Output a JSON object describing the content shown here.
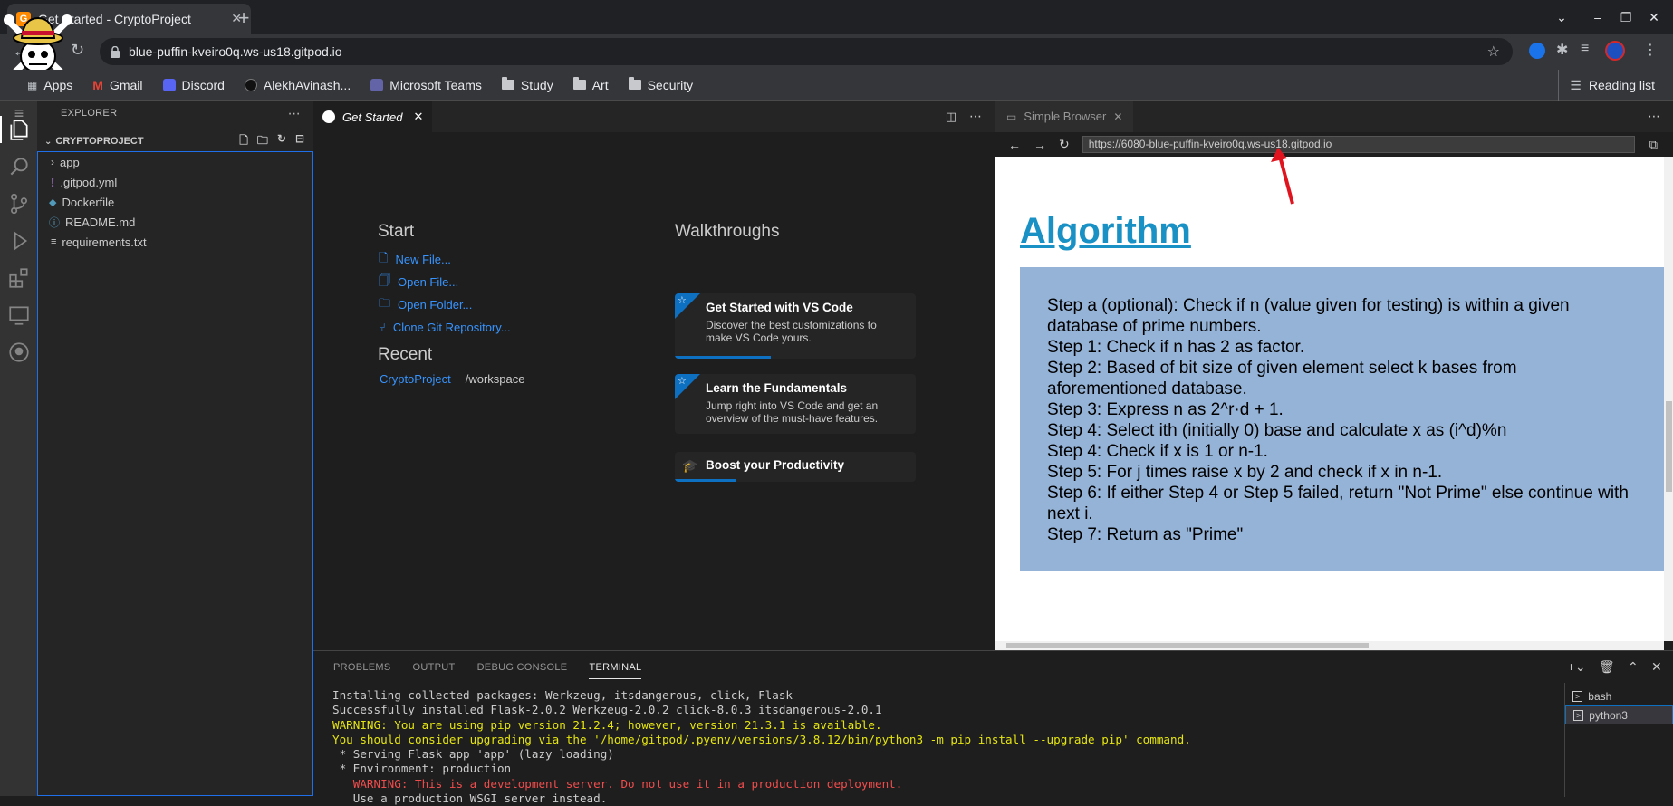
{
  "chrome": {
    "tab_title": "Get Started - CryptoProject",
    "url": "blue-puffin-kveiro0q.ws-us18.gitpod.io",
    "bookmarks": [
      "Apps",
      "Gmail",
      "Discord",
      "AlekhAvinash...",
      "Microsoft Teams",
      "Study",
      "Art",
      "Security"
    ],
    "reading_list": "Reading list"
  },
  "explorer": {
    "header": "EXPLORER",
    "project": "CRYPTOPROJECT",
    "files": [
      "app",
      ".gitpod.yml",
      "Dockerfile",
      "README.md",
      "requirements.txt"
    ]
  },
  "editor": {
    "tab_label": "Get Started",
    "start_heading": "Start",
    "start_links": [
      "New File...",
      "Open File...",
      "Open Folder...",
      "Clone Git Repository..."
    ],
    "recent_heading": "Recent",
    "recent_project": "CryptoProject",
    "recent_path": "/workspace",
    "walkthroughs_heading": "Walkthroughs",
    "walkthroughs": [
      {
        "title": "Get Started with VS Code",
        "desc": "Discover the best customizations to make VS Code yours.",
        "progress": 0.4
      },
      {
        "title": "Learn the Fundamentals",
        "desc": "Jump right into VS Code and get an overview of the must-have features.",
        "progress": 0
      },
      {
        "title": "Boost your Productivity",
        "desc": "",
        "progress": 0.25
      }
    ]
  },
  "browser": {
    "tab_label": "Simple Browser",
    "url": "https://6080-blue-puffin-kveiro0q.ws-us18.gitpod.io",
    "heading": "Algorithm",
    "steps": [
      "Step a (optional): Check if n (value given for testing) is within a given database of prime numbers.",
      "Step 1: Check if n has 2 as factor.",
      "Step 2: Based of bit size of given element select k bases from aforementioned database.",
      "Step 3: Express n as 2^r·d + 1.",
      "Step 4: Select ith (initially 0) base and calculate x as (i^d)%n",
      "Step 4: Check if x is 1 or n-1.",
      "Step 5: For j times raise x by 2 and check if x in n-1.",
      "Step 6: If either Step 4 or Step 5 failed, return \"Not Prime\" else continue with next i.",
      "Step 7: Return as \"Prime\""
    ]
  },
  "panel": {
    "tabs": [
      "PROBLEMS",
      "OUTPUT",
      "DEBUG CONSOLE",
      "TERMINAL"
    ],
    "active_tab": "TERMINAL",
    "terminal_lines": [
      {
        "text": "Installing collected packages: Werkzeug, itsdangerous, click, Flask",
        "color": "#cccccc"
      },
      {
        "text": "Successfully installed Flask-2.0.2 Werkzeug-2.0.2 click-8.0.3 itsdangerous-2.0.1",
        "color": "#cccccc"
      },
      {
        "text": "WARNING: You are using pip version 21.2.4; however, version 21.3.1 is available.",
        "color": "#e5e510"
      },
      {
        "text": "You should consider upgrading via the '/home/gitpod/.pyenv/versions/3.8.12/bin/python3 -m pip install --upgrade pip' command.",
        "color": "#e5e510"
      },
      {
        "text": " * Serving Flask app 'app' (lazy loading)",
        "color": "#cccccc"
      },
      {
        "text": " * Environment: production",
        "color": "#cccccc"
      },
      {
        "text": "   WARNING: This is a development server. Do not use it in a production deployment.",
        "color": "#f14c4c"
      },
      {
        "text": "   Use a production WSGI server instead.",
        "color": "#cccccc"
      }
    ],
    "terminals": [
      "bash",
      "python3"
    ]
  }
}
